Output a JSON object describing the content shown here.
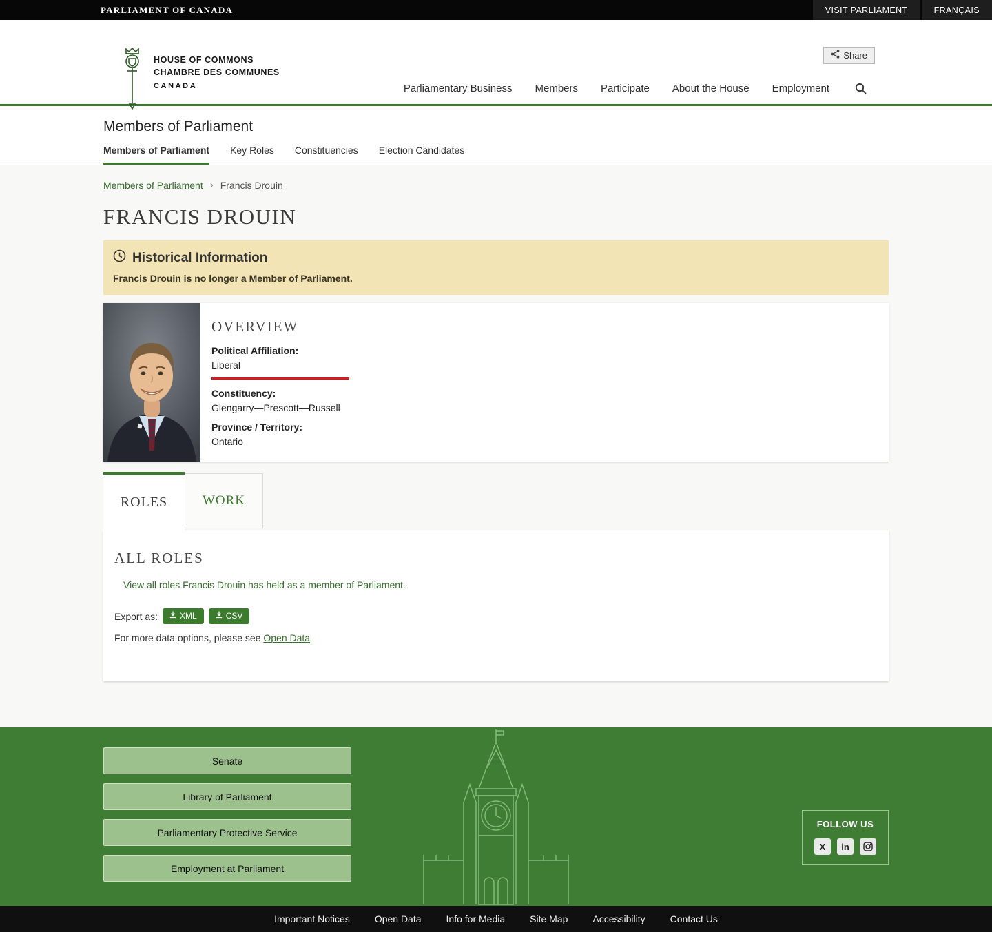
{
  "top_bar": {
    "brand": "PARLIAMENT OF CANADA",
    "visit": "VISIT PARLIAMENT",
    "language": "FRANÇAIS"
  },
  "header": {
    "logo_line1": "HOUSE OF COMMONS",
    "logo_line2": "CHAMBRE DES COMMUNES",
    "logo_line3": "CANADA",
    "share_label": "Share",
    "nav": [
      {
        "label": "Parliamentary Business"
      },
      {
        "label": "Members"
      },
      {
        "label": "Participate"
      },
      {
        "label": "About the House"
      },
      {
        "label": "Employment"
      }
    ]
  },
  "section_header": {
    "title": "Members of Parliament",
    "tabs": [
      {
        "label": "Members of Parliament",
        "active": true
      },
      {
        "label": "Key Roles",
        "active": false
      },
      {
        "label": "Constituencies",
        "active": false
      },
      {
        "label": "Election Candidates",
        "active": false
      }
    ]
  },
  "breadcrumb": {
    "parent": "Members of Parliament",
    "current": "Francis Drouin"
  },
  "page": {
    "title": "FRANCIS DROUIN"
  },
  "notice": {
    "title": "Historical Information",
    "message": "Francis Drouin is no longer a Member of Parliament."
  },
  "overview": {
    "heading": "OVERVIEW",
    "political_affiliation_label": "Political Affiliation:",
    "political_affiliation": "Liberal",
    "constituency_label": "Constituency:",
    "constituency": "Glengarry—Prescott—Russell",
    "province_label": "Province / Territory:",
    "province": "Ontario"
  },
  "tabs": {
    "roles": "ROLES",
    "work": "WORK"
  },
  "all_roles": {
    "heading": "ALL ROLES",
    "link": "View all roles Francis Drouin has held as a member of Parliament.",
    "export_label": "Export as:",
    "xml": "XML",
    "csv": "CSV",
    "more_text": "For more data options, please see",
    "open_data": "Open Data"
  },
  "footer": {
    "buttons": [
      {
        "label": "Senate"
      },
      {
        "label": "Library of Parliament"
      },
      {
        "label": "Parliamentary Protective Service"
      },
      {
        "label": "Employment at Parliament"
      }
    ],
    "follow_us": "FOLLOW US",
    "social": [
      {
        "name": "x-twitter-icon",
        "glyph": "X"
      },
      {
        "name": "linkedin-icon",
        "glyph": "in"
      },
      {
        "name": "instagram-icon",
        "glyph": ""
      }
    ]
  },
  "bottom_bar": {
    "links": [
      {
        "label": "Important Notices"
      },
      {
        "label": "Open Data"
      },
      {
        "label": "Info for Media"
      },
      {
        "label": "Site Map"
      },
      {
        "label": "Accessibility"
      },
      {
        "label": "Contact Us"
      }
    ]
  },
  "colors": {
    "accent_green": "#3c7a2e",
    "footer_green": "#3f7d35",
    "liberal_red": "#d71920",
    "notice_bg": "#f2e4b4"
  }
}
